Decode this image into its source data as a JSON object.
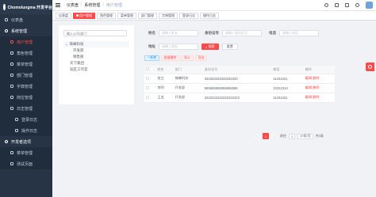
{
  "brand": {
    "title": "Chomolungma 开发平台"
  },
  "sidebar": {
    "items": [
      {
        "label": "仪表盘",
        "level": 0,
        "icon": "dashboard-icon"
      },
      {
        "label": "系统管理",
        "level": 0,
        "icon": "system-icon",
        "open": true
      },
      {
        "label": "用户管理",
        "level": 1,
        "icon": "user-icon",
        "active": true
      },
      {
        "label": "角色管理",
        "level": 1,
        "icon": "role-icon"
      },
      {
        "label": "菜单管理",
        "level": 1,
        "icon": "menu-icon"
      },
      {
        "label": "部门管理",
        "level": 1,
        "icon": "dept-icon"
      },
      {
        "label": "字典管理",
        "level": 1,
        "icon": "dict-icon"
      },
      {
        "label": "岗位管理",
        "level": 1,
        "icon": "post-icon"
      },
      {
        "label": "日志管理",
        "level": 1,
        "icon": "log-icon"
      },
      {
        "label": "登录日志",
        "level": 2,
        "icon": "login-log-icon"
      },
      {
        "label": "操作日志",
        "level": 2,
        "icon": "oper-log-icon"
      },
      {
        "label": "开发者选项",
        "level": 0,
        "icon": "developer-icon",
        "open": true
      },
      {
        "label": "菜单管理",
        "level": 1,
        "icon": "menu-icon"
      },
      {
        "label": "测试页面",
        "level": 1,
        "icon": "test-icon"
      }
    ]
  },
  "breadcrumb": {
    "items": [
      "仪表盘",
      "系统管理",
      "用户管理"
    ],
    "sep": "/"
  },
  "tags": [
    {
      "label": "仪表盘"
    },
    {
      "label": "用户管理",
      "active": true
    },
    {
      "label": "角色管理"
    },
    {
      "label": "菜单管理"
    },
    {
      "label": "部门管理"
    },
    {
      "label": "字典管理"
    },
    {
      "label": "登录日志"
    },
    {
      "label": "操作日志"
    }
  ],
  "tree": {
    "search_placeholder": "输入公司/部门",
    "nodes": [
      {
        "label": "珠峰科技",
        "level": 1,
        "expanded": true
      },
      {
        "label": "开发部",
        "level": 2
      },
      {
        "label": "销售部",
        "level": 2
      },
      {
        "label": "天下集团",
        "level": 1
      },
      {
        "label": "韬区工作室",
        "level": 1
      }
    ]
  },
  "search_form": {
    "name_label": "姓名",
    "name_placeholder": "请输入姓名",
    "idcard_label": "身份证号",
    "idcard_placeholder": "请输入身份证号",
    "phone_label": "电话",
    "phone_placeholder": "请输入电话",
    "address_label": "地址",
    "address_placeholder": "请输入地址",
    "search_button": "搜索",
    "reset_button": "重置"
  },
  "toolbar": {
    "add": "+ 新增",
    "batch_delete": "批量删除",
    "import": "导入",
    "export": "导出"
  },
  "table": {
    "columns": [
      "姓名",
      "部门",
      "身份证号",
      "电话",
      "操作"
    ],
    "rows": [
      {
        "name": "张三",
        "dept": "珠峰科技",
        "idcard": "333333333333333333",
        "phone": "11231231",
        "edit": "编辑",
        "del": "删除"
      },
      {
        "name": "李四",
        "dept": "开发部",
        "idcard": "555555555555555555",
        "phone": "12312313",
        "edit": "编辑",
        "del": "删除"
      },
      {
        "name": "王五",
        "dept": "开发部",
        "idcard": "2222222222222222222",
        "phone": "11231231",
        "edit": "编辑",
        "del": "删除"
      }
    ]
  },
  "pagination": {
    "current": "1",
    "goto_label": "前往",
    "goto_value": "1",
    "page_size": "10条/页",
    "total": "共3条"
  },
  "colors": {
    "accent": "#ff4949",
    "sidebar_bg": "#263445"
  }
}
